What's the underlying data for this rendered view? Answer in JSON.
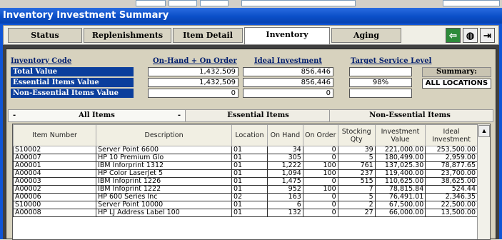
{
  "window": {
    "title": "Inventory Investment Summary"
  },
  "tabs": [
    {
      "label": "Status"
    },
    {
      "label": "Replenishments"
    },
    {
      "label": "Item Detail"
    },
    {
      "label": "Inventory"
    },
    {
      "label": "Aging"
    }
  ],
  "toolbar_icons": [
    "back-arrow-icon",
    "globe-icon",
    "exit-door-icon"
  ],
  "headers": {
    "code": "Inventory Code",
    "onhand": "On-Hand + On Order",
    "ideal": "Ideal Investment",
    "target": "Target Service Level"
  },
  "summary_rows": [
    {
      "label": "Total Value",
      "onhand": "1,432,509",
      "ideal": "856,446",
      "target": ""
    },
    {
      "label": "Essential Items Value",
      "onhand": "1,432,509",
      "ideal": "856,446",
      "target": "98%"
    },
    {
      "label": "Non-Essential Items Value",
      "onhand": "0",
      "ideal": "0",
      "target": ""
    }
  ],
  "summary": {
    "label": "Summary:",
    "value": "ALL LOCATIONS"
  },
  "subtabs": {
    "all": "All Items",
    "essential": "Essential Items",
    "non_essential": "Non-Essential Items"
  },
  "grid": {
    "columns": [
      "Item Number",
      "Description",
      "Location",
      "On Hand",
      "On Order",
      "Stocking Qty",
      "Investment Value",
      "Ideal Investment"
    ],
    "rows": [
      [
        "S10002",
        "Server Point 6600",
        "01",
        "34",
        "0",
        "39",
        "221,000.00",
        "253,500.00"
      ],
      [
        "A00007",
        "HP 10 Premium Glo",
        "01",
        "305",
        "0",
        "5",
        "180,499.00",
        "2,959.00"
      ],
      [
        "A00001",
        "IBM Inforprint 1312",
        "01",
        "1,222",
        "100",
        "761",
        "137,025.30",
        "78,877.65"
      ],
      [
        "A00004",
        "HP Color LaserJet 5",
        "01",
        "1,094",
        "100",
        "237",
        "119,400.00",
        "23,700.00"
      ],
      [
        "A00003",
        "IBM Infoprint 1226",
        "01",
        "1,475",
        "0",
        "515",
        "110,625.00",
        "38,625.00"
      ],
      [
        "A00002",
        "IBM Infoprint 1222",
        "01",
        "952",
        "100",
        "7",
        "78,815.84",
        "524.44"
      ],
      [
        "A00006",
        "HP 600 Series Inc",
        "02",
        "163",
        "0",
        "5",
        "76,491.01",
        "2,346.35"
      ],
      [
        "S10000",
        "Server Point 10000",
        "01",
        "6",
        "0",
        "2",
        "67,500.00",
        "22,500.00"
      ],
      [
        "A00008",
        "HP LJ Address Label 100",
        "01",
        "132",
        "0",
        "27",
        "66,000.00",
        "13,500.00"
      ]
    ]
  }
}
